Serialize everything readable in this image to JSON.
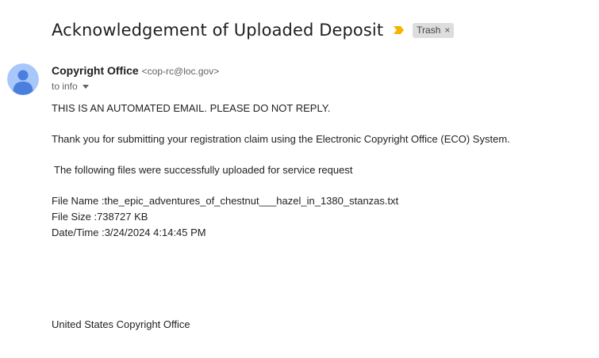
{
  "email": {
    "subject": "Acknowledgement of Uploaded Deposit",
    "label": "Trash",
    "label_close": "×",
    "sender_name": "Copyright Office",
    "sender_email": "<cop-rc@loc.gov>",
    "recipient_line": "to info",
    "body": {
      "line1": "THIS IS AN AUTOMATED EMAIL. PLEASE DO NOT REPLY.",
      "line2": "Thank you for submitting your registration claim using the Electronic Copyright Office (ECO) System.",
      "line3": "The following files were successfully uploaded for service request",
      "file_name": "File Name :the_epic_adventures_of_chestnut___hazel_in_1380_stanzas.txt",
      "file_size": "File Size :738727 KB",
      "date_time": "Date/Time :3/24/2024 4:14:45 PM",
      "signature": "United States Copyright Office"
    }
  },
  "icons": {
    "importance": "importance-marker-icon",
    "avatar": "default-avatar-icon",
    "dropdown": "chevron-down-icon"
  },
  "colors": {
    "importance_marker": "#f4b400",
    "avatar_bg": "#a8c7fa",
    "avatar_figure": "#4a7fe0",
    "label_bg": "#dddddd"
  }
}
